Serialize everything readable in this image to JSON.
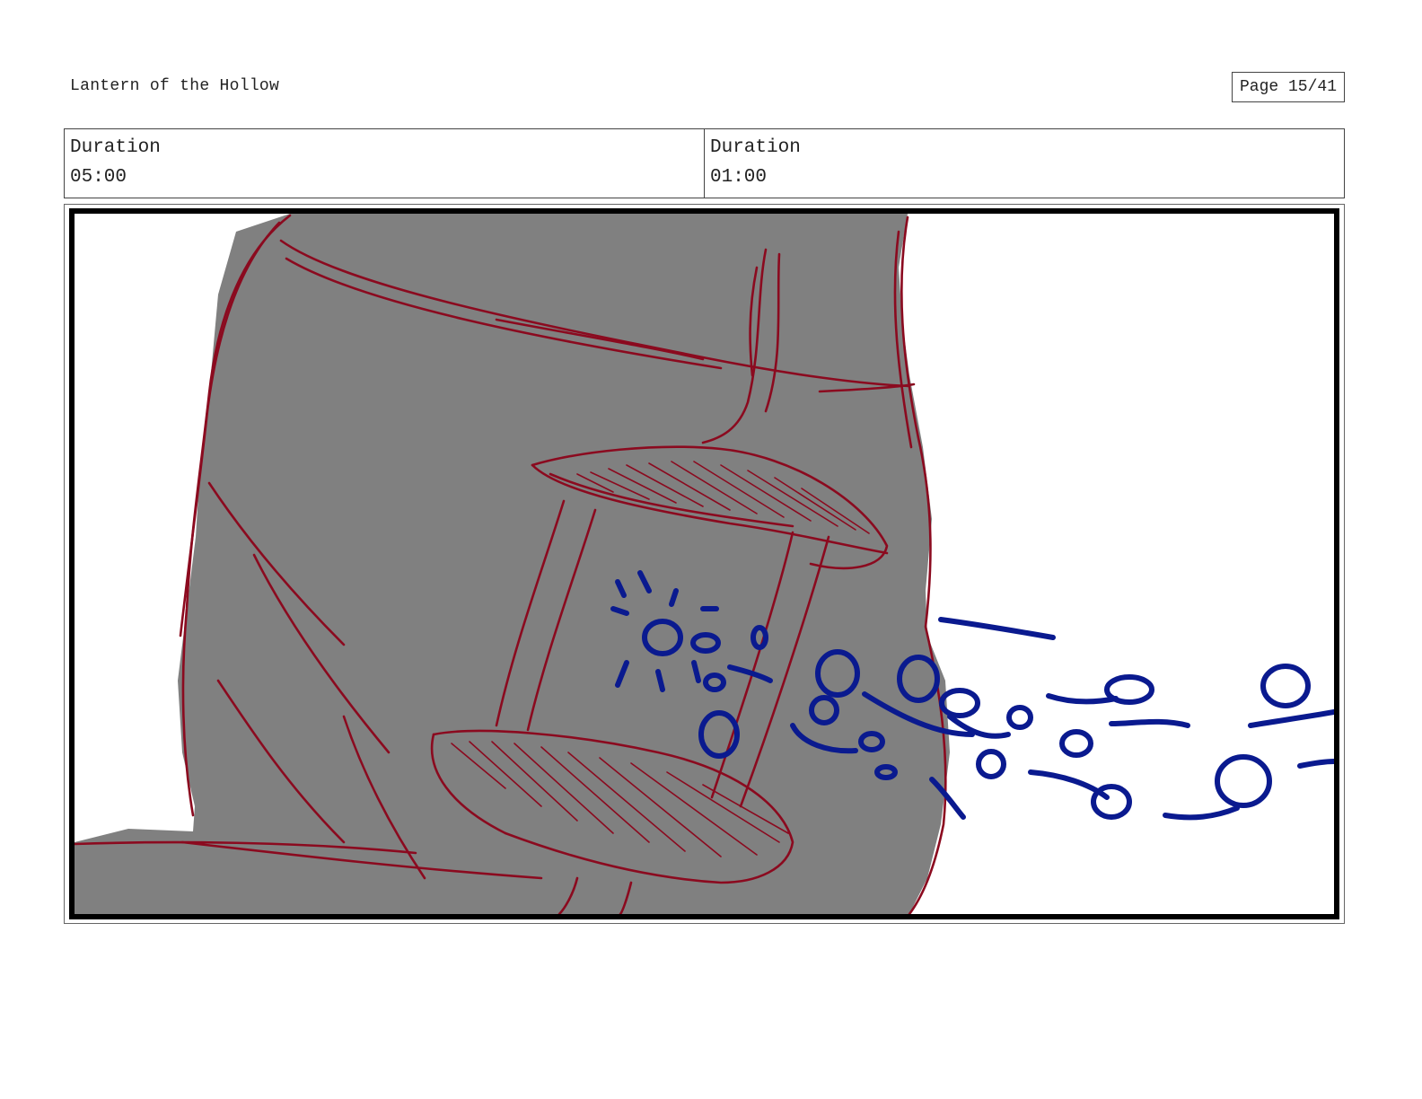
{
  "header": {
    "project_title": "Lantern of the Hollow",
    "page_label": "Page 15/41"
  },
  "shot_info": [
    {
      "label": "Duration",
      "value": "05:00"
    },
    {
      "label": "Duration",
      "value": "01:00"
    }
  ],
  "panel": {
    "colors": {
      "fill": "#808080",
      "sketch_line": "#8b0a1f",
      "effect_line": "#0a1a8f",
      "frame": "#000000"
    }
  }
}
